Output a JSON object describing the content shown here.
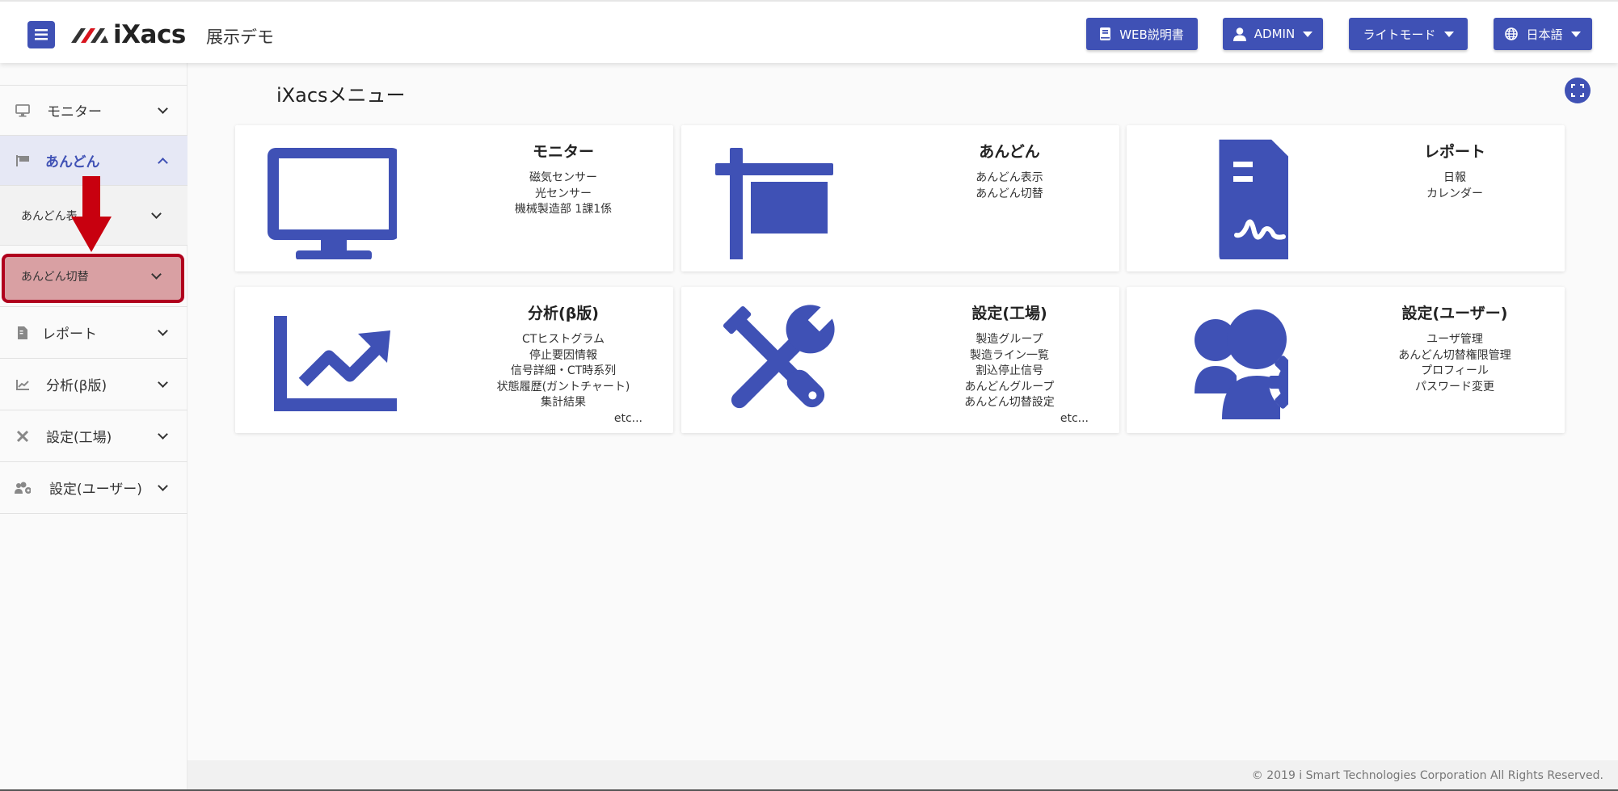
{
  "header": {
    "site_name": "展示デモ",
    "logo_text": "iXacs",
    "manual_label": "WEB説明書",
    "user_label": "ADMIN",
    "mode_label": "ライトモード",
    "lang_label": "日本語"
  },
  "sidebar": {
    "items": [
      {
        "label": "モニター",
        "icon": "monitor-icon"
      },
      {
        "label": "あんどん",
        "icon": "flag-icon",
        "active": true
      },
      {
        "label": "あんどん表",
        "icon": ""
      },
      {
        "label": "あんどん切替",
        "icon": ""
      },
      {
        "label": "レポート",
        "icon": "report-icon"
      },
      {
        "label": "分析(β版)",
        "icon": "chart-icon"
      },
      {
        "label": "設定(工場)",
        "icon": "tools-icon"
      },
      {
        "label": "設定(ユーザー)",
        "icon": "users-cog-icon"
      }
    ]
  },
  "main": {
    "title": "iXacsメニュー",
    "cards": [
      {
        "title": "モニター",
        "items": [
          "磁気センサー",
          "光センサー",
          "機械製造部 1課1係"
        ],
        "etc": ""
      },
      {
        "title": "あんどん",
        "items": [
          "あんどん表示",
          "あんどん切替"
        ],
        "etc": ""
      },
      {
        "title": "レポート",
        "items": [
          "日報",
          "カレンダー"
        ],
        "etc": ""
      },
      {
        "title": "分析(β版)",
        "items": [
          "CTヒストグラム",
          "停止要因情報",
          "信号詳細・CT時系列",
          "状態履歴(ガントチャート)",
          "集計結果"
        ],
        "etc": "etc..."
      },
      {
        "title": "設定(工場)",
        "items": [
          "製造グループ",
          "製造ライン一覧",
          "割込停止信号",
          "あんどんグループ",
          "あんどん切替設定"
        ],
        "etc": "etc..."
      },
      {
        "title": "設定(ユーザー)",
        "items": [
          "ユーザ管理",
          "あんどん切替権限管理",
          "プロフィール",
          "パスワード変更"
        ],
        "etc": ""
      }
    ]
  },
  "footer": {
    "copyright": "© 2019 i Smart Technologies Corporation All Rights Reserved."
  },
  "colors": {
    "accent": "#3f51b5",
    "highlight": "#d9a0a3",
    "highlight_border": "#b0001d",
    "arrow": "#c8000f"
  }
}
